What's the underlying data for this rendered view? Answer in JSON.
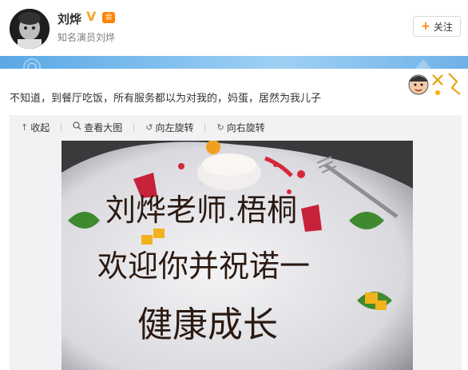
{
  "user": {
    "name": "刘烨",
    "verified_badge": "V",
    "vip_badge": "会",
    "description": "知名演员刘烨"
  },
  "follow": {
    "label": "关注",
    "icon": "+"
  },
  "post": {
    "text": "不知道，到餐厅吃饭，所有服务都以为对我的，妈蛋，居然为我儿子"
  },
  "media_toolbar": {
    "collapse": "收起",
    "view_large": "查看大图",
    "rotate_left": "向左旋转",
    "rotate_right": "向右旋转"
  },
  "plate_message": {
    "line1": "刘烨老师.梧桐",
    "line2": "欢迎你并祝诺一",
    "line3": "健康成长"
  },
  "colors": {
    "accent": "#ff8200",
    "banner": "#7bbcee",
    "chocolate": "#2b1a12"
  }
}
